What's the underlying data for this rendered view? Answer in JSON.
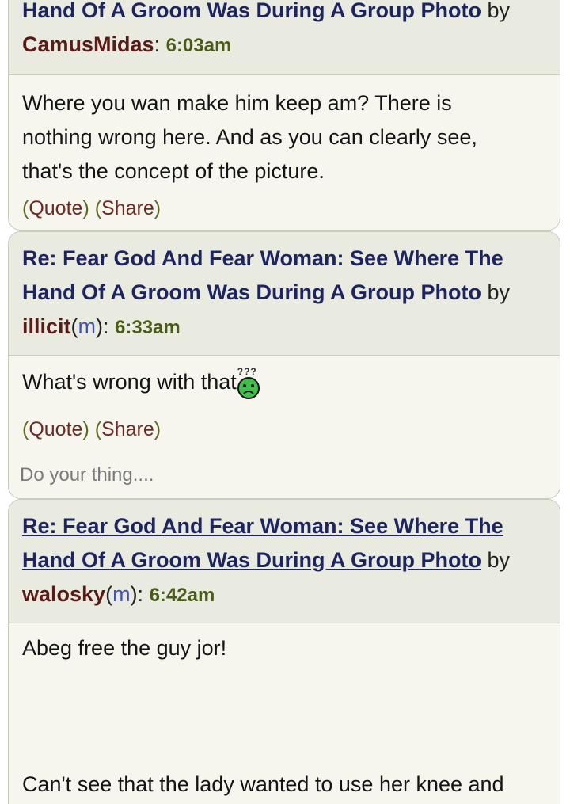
{
  "posts": [
    {
      "title_line1": "",
      "title_line2": "Hand Of A Groom Was During A Group Photo",
      "by": "by",
      "author": "CamusMidas",
      "mod": "",
      "time": "6:03am",
      "body_lines": [
        "Where you wan make him keep am? There is",
        "nothing wrong here. And as you can clearly see,",
        "that's the concept of the picture."
      ],
      "quote": "Quote",
      "share": "Share"
    },
    {
      "title_line1": "Re: Fear God And Fear Woman: See Where The",
      "title_line2": "Hand Of A Groom Was During A Group Photo",
      "by": "by",
      "author": "illicit",
      "mod": "m",
      "time": "6:33am",
      "body_lines": [
        "What's wrong with that"
      ],
      "emoji_marks": "???",
      "quote": "Quote",
      "share": "Share"
    },
    {
      "title_line1": "Re: Fear God And Fear Woman: See Where The",
      "title_line2": "Hand Of A Groom Was During A Group Photo",
      "by": "by",
      "author": "walosky",
      "mod": "m",
      "time": "6:42am",
      "body_lines": [
        "Abeg free the guy jor!",
        "Can't see that the lady wanted to use her knee and"
      ]
    }
  ],
  "reply_box": {
    "placeholder": "Do your thing...."
  }
}
